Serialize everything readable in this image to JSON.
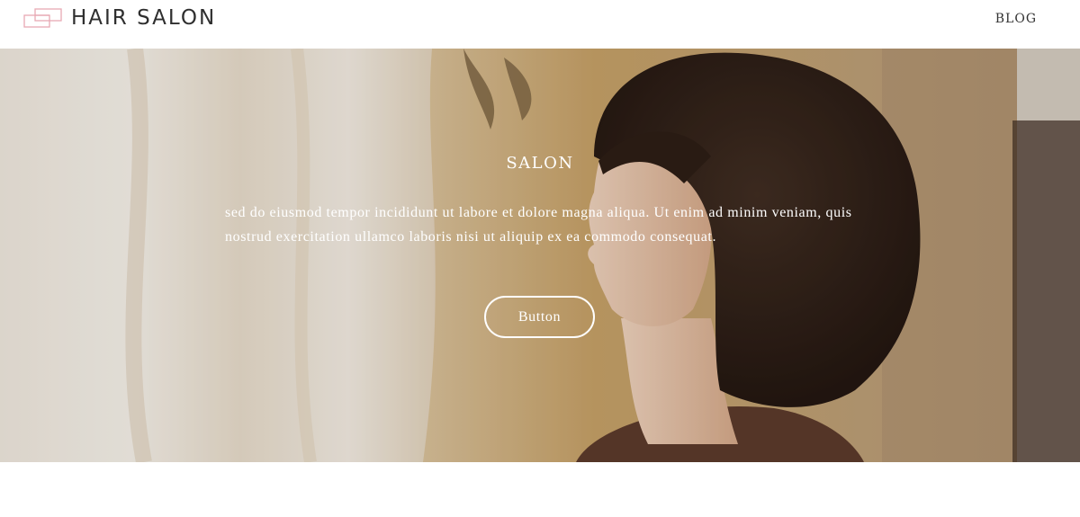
{
  "header": {
    "logo_text": "HAIR SALON",
    "nav": [
      {
        "label": "BLOG"
      }
    ]
  },
  "hero": {
    "title": "SALON",
    "body": "sed do eiusmod tempor incididunt ut labore et dolore magna aliqua. Ut enim ad minim veniam, quis nostrud exercitation ullamco laboris nisi ut aliquip ex ea commodo consequat.",
    "button_label": "Button",
    "image_alt": "photo-woman-profile-bob-haircut"
  },
  "colors": {
    "logo_accent": "#e7a9b4",
    "text_dark": "#2f2f2f",
    "hero_text": "#ffffff"
  }
}
